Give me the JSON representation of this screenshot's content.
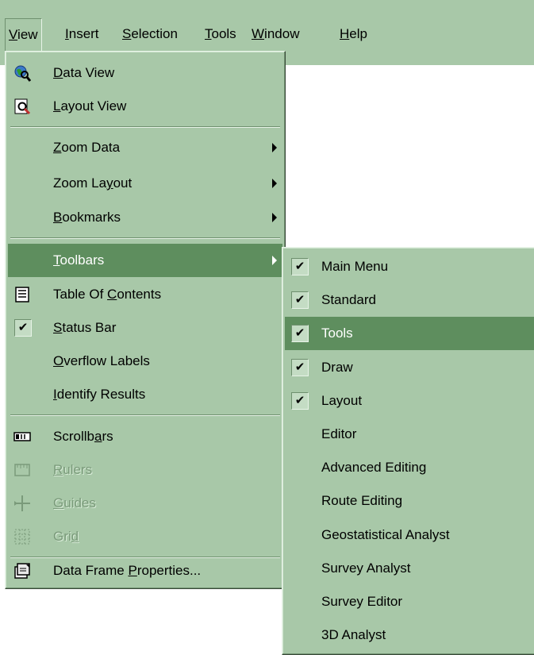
{
  "menubar": {
    "items": [
      {
        "pre": "",
        "u": "V",
        "post": "iew"
      },
      {
        "pre": "",
        "u": "I",
        "post": "nsert"
      },
      {
        "pre": "",
        "u": "S",
        "post": "election"
      },
      {
        "pre": "",
        "u": "T",
        "post": "ools"
      },
      {
        "pre": "",
        "u": "W",
        "post": "indow"
      },
      {
        "pre": "",
        "u": "H",
        "post": "elp"
      }
    ]
  },
  "view_menu": {
    "data_view": {
      "pre": "",
      "u": "D",
      "post": "ata View",
      "icon": "globe-magnifier-icon"
    },
    "layout_view": {
      "pre": "",
      "u": "L",
      "post": "ayout View",
      "icon": "page-magnifier-icon"
    },
    "zoom_data": {
      "pre": "",
      "u": "Z",
      "post": "oom Data"
    },
    "zoom_layout": {
      "pre": "Zoom La",
      "u": "y",
      "post": "out"
    },
    "bookmarks": {
      "pre": "",
      "u": "B",
      "post": "ookmarks"
    },
    "toolbars": {
      "pre": "",
      "u": "T",
      "post": "oolbars"
    },
    "table_of_contents": {
      "pre": "Table Of ",
      "u": "C",
      "post": "ontents",
      "icon": "document-list-icon"
    },
    "status_bar": {
      "pre": "",
      "u": "S",
      "post": "tatus Bar",
      "check": "✔"
    },
    "overflow_labels": {
      "pre": "",
      "u": "O",
      "post": "verflow Labels"
    },
    "identify_results": {
      "pre": "",
      "u": "I",
      "post": "dentify Results"
    },
    "scrollbars": {
      "pre": "Scrollb",
      "u": "a",
      "post": "rs",
      "icon": "scrollbar-icon"
    },
    "rulers": {
      "pre": "",
      "u": "R",
      "post": "ulers",
      "icon": "ruler-icon"
    },
    "guides": {
      "pre": "",
      "u": "G",
      "post": "uides",
      "icon": "guides-icon"
    },
    "grid": {
      "pre": "Gri",
      "u": "d",
      "post": "",
      "icon": "grid-icon"
    },
    "data_frame_properties": {
      "pre": "Data Frame ",
      "u": "P",
      "post": "roperties...",
      "icon": "properties-icon"
    }
  },
  "toolbars_submenu": {
    "check_glyph": "✔",
    "items": [
      {
        "label": "Main Menu",
        "checked": true
      },
      {
        "label": "Standard",
        "checked": true
      },
      {
        "label": "Tools",
        "checked": true
      },
      {
        "label": "Draw",
        "checked": true
      },
      {
        "label": "Layout",
        "checked": true
      },
      {
        "label": "Editor",
        "checked": false
      },
      {
        "label": "Advanced Editing",
        "checked": false
      },
      {
        "label": "Route Editing",
        "checked": false
      },
      {
        "label": "Geostatistical Analyst",
        "checked": false
      },
      {
        "label": "Survey Analyst",
        "checked": false
      },
      {
        "label": "Survey Editor",
        "checked": false
      },
      {
        "label": "3D Analyst",
        "checked": false
      }
    ]
  },
  "colors": {
    "menu_bg": "#a8c8a8",
    "highlight": "#5e8e5e",
    "disabled_text": "#7a9a7a"
  }
}
